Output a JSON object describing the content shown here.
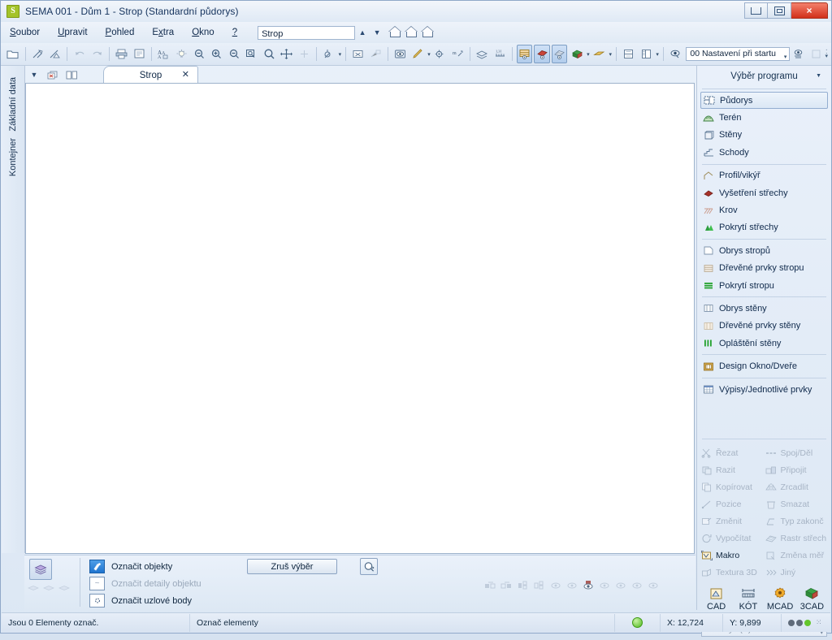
{
  "window": {
    "title": "SEMA  001 - Dům 1  - Strop (Standardní půdorys)",
    "logo_letter": "S",
    "minimize_label": "Minimalizovat",
    "maximize_label": "Maximalizovat",
    "close_label": "×"
  },
  "menu": {
    "items": [
      {
        "label": "Soubor",
        "accel": "S"
      },
      {
        "label": "Upravit",
        "accel": "U"
      },
      {
        "label": "Pohled",
        "accel": "P"
      },
      {
        "label": "Extra",
        "accel": "x"
      },
      {
        "label": "Okno",
        "accel": "O"
      },
      {
        "label": "?",
        "accel": ""
      }
    ],
    "storey_value": "Strop",
    "storey_up": "▲",
    "storey_down": "▼"
  },
  "toolbar": {
    "startup_setting": "00 Nastavení při startu",
    "icons": [
      "open-folder-icon",
      "cut-roof-icon",
      "cut-angle-icon",
      "undo-icon",
      "redo-icon",
      "print-icon",
      "print-preview-icon",
      "text-icon",
      "light-bulb-icon",
      "zoom-out-icon",
      "zoom-in-icon",
      "zoom-previous-icon",
      "zoom-window-icon",
      "zoom-all-icon",
      "pan-icon",
      "rotate-icon",
      "snap-icon",
      "erase-icon",
      "measure-icon",
      "eye-icon",
      "pen-icon",
      "settings-gear-icon",
      "dimension-icon",
      "layers-icon",
      "scale-icon",
      "view-plan-icon",
      "view-solid-icon",
      "view-wire-icon",
      "3d-view-icon",
      "clip-icon",
      "split-horizontal-icon",
      "split-vertical-icon",
      "visibility-icon",
      "visibility-settings-icon",
      "locked-icon"
    ]
  },
  "left_strip": {
    "label_top": "Základní data",
    "label_bottom": "Kontejner"
  },
  "tabs": {
    "controls": [
      "chevron-down-icon",
      "close-window-icon",
      "tile-windows-icon"
    ],
    "open": [
      {
        "label": "Strop",
        "close": "✕",
        "active": true
      }
    ]
  },
  "program_panel": {
    "header": "Výběr programu",
    "groups": [
      {
        "items": [
          {
            "label": "Půdorys",
            "icon": "floorplan-icon",
            "selected": true
          },
          {
            "label": "Terén",
            "icon": "terrain-icon",
            "selected": false
          },
          {
            "label": "Stěny",
            "icon": "walls-icon",
            "selected": false
          },
          {
            "label": "Schody",
            "icon": "stairs-icon",
            "selected": false
          }
        ]
      },
      {
        "items": [
          {
            "label": "Profil/vikýř",
            "icon": "dormer-icon",
            "selected": false
          },
          {
            "label": "Vyšetření střechy",
            "icon": "roof-analysis-icon",
            "selected": false
          },
          {
            "label": "Krov",
            "icon": "rafter-icon",
            "selected": false
          },
          {
            "label": "Pokrytí střechy",
            "icon": "roof-cover-icon",
            "selected": false
          }
        ]
      },
      {
        "items": [
          {
            "label": "Obrys stropů",
            "icon": "ceiling-outline-icon",
            "selected": false
          },
          {
            "label": "Dřevěné prvky stropu",
            "icon": "ceiling-timber-icon",
            "selected": false
          },
          {
            "label": "Pokrytí stropu",
            "icon": "ceiling-cover-icon",
            "selected": false
          }
        ]
      },
      {
        "items": [
          {
            "label": "Obrys stěny",
            "icon": "wall-outline-icon",
            "selected": false
          },
          {
            "label": "Dřevěné prvky stěny",
            "icon": "wall-timber-icon",
            "selected": false
          },
          {
            "label": "Opláštění stěny",
            "icon": "wall-cladding-icon",
            "selected": false
          }
        ]
      },
      {
        "items": [
          {
            "label": "Design Okno/Dveře",
            "icon": "window-door-icon",
            "selected": false
          }
        ]
      },
      {
        "items": [
          {
            "label": "Výpisy/Jednotlivé prvky",
            "icon": "list-parts-icon",
            "selected": false
          }
        ]
      }
    ]
  },
  "commands": [
    {
      "label": "Řezat",
      "icon": "scissors-icon",
      "enabled": false
    },
    {
      "label": "Spoj/Děl",
      "icon": "join-split-icon",
      "enabled": false
    },
    {
      "label": "Razit",
      "icon": "stamp-icon",
      "enabled": false
    },
    {
      "label": "Připojit",
      "icon": "attach-icon",
      "enabled": false
    },
    {
      "label": "Kopírovat",
      "icon": "copy-icon",
      "enabled": false
    },
    {
      "label": "Zrcadlit",
      "icon": "mirror-icon",
      "enabled": false
    },
    {
      "label": "Pozice",
      "icon": "position-icon",
      "enabled": false
    },
    {
      "label": "Smazat",
      "icon": "trash-icon",
      "enabled": false
    },
    {
      "label": "Změnit",
      "icon": "modify-icon",
      "enabled": false
    },
    {
      "label": "Typ zakonč",
      "icon": "end-type-icon",
      "enabled": false
    },
    {
      "label": "Vypočítat",
      "icon": "calculate-icon",
      "enabled": false
    },
    {
      "label": "Rastr střech",
      "icon": "roof-grid-icon",
      "enabled": false
    },
    {
      "label": "Makro",
      "icon": "macro-icon",
      "enabled": true
    },
    {
      "label": "Změna měř",
      "icon": "scale-change-icon",
      "enabled": false
    },
    {
      "label": "Textura 3D",
      "icon": "texture3d-icon",
      "enabled": false
    },
    {
      "label": "Jiný",
      "icon": "other-icon",
      "enabled": false
    }
  ],
  "modes": [
    {
      "label": "CAD",
      "icon": "cad-icon"
    },
    {
      "label": "KÓT",
      "icon": "dimension-mode-icon"
    },
    {
      "label": "MCAD",
      "icon": "mcad-gear-icon"
    },
    {
      "label": "3CAD",
      "icon": "3cad-cube-icon"
    }
  ],
  "view_combo": {
    "value": "Půdorys  (V)",
    "caret": "▾"
  },
  "selection_panel": {
    "layer_icon": "layers-icon",
    "rows": [
      {
        "label": "Označit objekty",
        "icon": "select-object-icon",
        "active": true,
        "enabled": true
      },
      {
        "label": "Označit detaily objektu",
        "icon": "select-detail-icon",
        "active": false,
        "enabled": false
      },
      {
        "label": "Označit uzlové body",
        "icon": "select-node-icon",
        "active": false,
        "enabled": true
      }
    ],
    "clear_button": "Zruš výběr",
    "magnifier_icon": "magnifier-select-icon"
  },
  "status_bar": {
    "message": "Jsou 0 Elementy označ.",
    "hint": "Označ elementy",
    "coord_x": "X: 12,724",
    "coord_y": "Y: 9,899",
    "led_color": "#4fb81f"
  }
}
